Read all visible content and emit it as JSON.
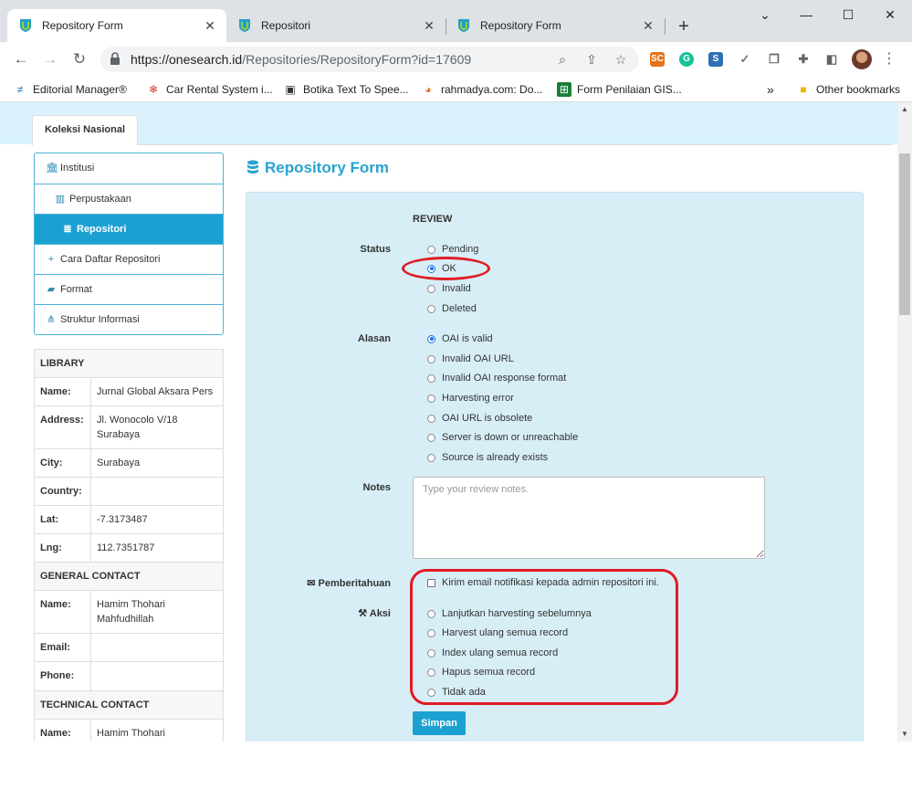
{
  "browser": {
    "tabs": [
      {
        "title": "Repository Form",
        "active": true
      },
      {
        "title": "Repositori",
        "active": false
      },
      {
        "title": "Repository Form",
        "active": false
      }
    ],
    "url_host": "https://onesearch.id",
    "url_path": "/Repositories/RepositoryForm?id=17609",
    "bookmarks": [
      "Editorial Manager®",
      "Car Rental System i...",
      "Botika Text To Spee...",
      "rahmadya.com: Do...",
      "Form Penilaian GIS...",
      "Other bookmarks"
    ],
    "extensions": [
      "SC"
    ]
  },
  "page": {
    "top_tab": "Koleksi Nasional",
    "title": "Repository Form",
    "sidebar": [
      {
        "label": "Institusi",
        "icon": "institution-icon"
      },
      {
        "label": "Perpustakaan",
        "icon": "building-icon"
      },
      {
        "label": "Repositori",
        "icon": "database-icon",
        "active": true
      },
      {
        "label": "Cara Daftar Repositori",
        "icon": "plus-icon"
      },
      {
        "label": "Format",
        "icon": "book-icon"
      },
      {
        "label": "Struktur Informasi",
        "icon": "sitemap-icon"
      }
    ],
    "library": {
      "section_library": "LIBRARY",
      "name_label": "Name:",
      "name": "Jurnal Global Aksara Pers",
      "address_label": "Address:",
      "address": "Jl. Wonocolo V/18 Surabaya",
      "city_label": "City:",
      "city": "Surabaya",
      "country_label": "Country:",
      "country": "",
      "lat_label": "Lat:",
      "lat": "-7.3173487",
      "lng_label": "Lng:",
      "lng": "112.7351787",
      "section_general": "GENERAL CONTACT",
      "gc_name_label": "Name:",
      "gc_name": "Hamim Thohari Mahfudhillah",
      "gc_email_label": "Email:",
      "gc_email": "",
      "gc_phone_label": "Phone:",
      "gc_phone": "",
      "section_technical": "TECHNICAL CONTACT",
      "tc_name_label": "Name:",
      "tc_name": "Hamim Thohari Mahfudhillah"
    },
    "form": {
      "review_heading": "REVIEW",
      "status_label": "Status",
      "status_options": [
        "Pending",
        "OK",
        "Invalid",
        "Deleted"
      ],
      "status_selected": "OK",
      "alasan_label": "Alasan",
      "alasan_options": [
        "OAI is valid",
        "Invalid OAI URL",
        "Invalid OAI response format",
        "Harvesting error",
        "OAI URL is obsolete",
        "Server is down or unreachable",
        "Source is already exists"
      ],
      "alasan_selected": "OAI is valid",
      "notes_label": "Notes",
      "notes_placeholder": "Type your review notes.",
      "notes_value": "",
      "pemberitahuan_label": "Pemberitahuan",
      "notify_checkbox_label": "Kirim email notifikasi kepada admin repositori ini.",
      "notify_checked": false,
      "aksi_label": "Aksi",
      "aksi_options": [
        "Lanjutkan harvesting sebelumnya",
        "Harvest ulang semua record",
        "Index ulang semua record",
        "Hapus semua record",
        "Tidak ada"
      ],
      "submit_label": "Simpan"
    },
    "annotation_color": "#e01c24",
    "accent_color": "#1aa1d1"
  }
}
